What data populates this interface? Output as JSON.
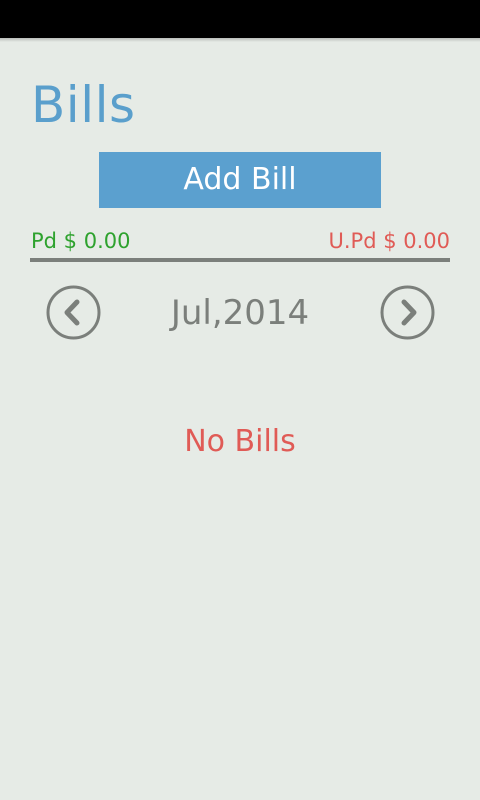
{
  "header": {
    "title": "Bills"
  },
  "actions": {
    "add_bill_label": "Add Bill"
  },
  "summary": {
    "paid_label": "Pd $ 0.00",
    "unpaid_label": "U.Pd $ 0.00"
  },
  "month_nav": {
    "current_month": "Jul,2014",
    "prev_icon": "chevron-left-circle-icon",
    "next_icon": "chevron-right-circle-icon"
  },
  "list": {
    "empty_message": "No Bills"
  },
  "colors": {
    "accent": "#5ba0cf",
    "paid": "#2ea22e",
    "unpaid": "#e05b56",
    "muted": "#7b7f7b",
    "background": "#e6ebe6"
  }
}
